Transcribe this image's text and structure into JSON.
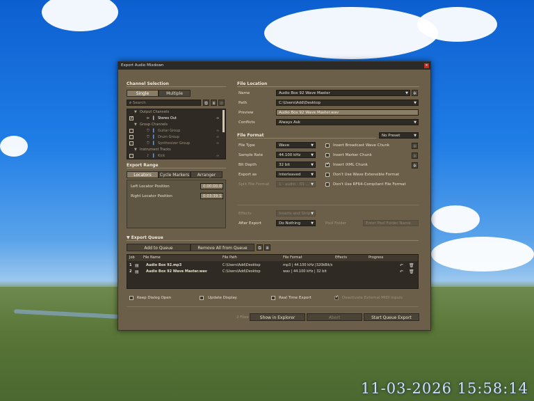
{
  "clock": "11-03-2026 15:58:14",
  "dialog": {
    "title": "Export Audio Mixdown",
    "close_glyph": "×"
  },
  "channel_selection": {
    "heading": "Channel Selection",
    "tabs": [
      "Single",
      "Multiple"
    ],
    "search_placeholder": "Search",
    "tree": [
      {
        "label": "Output Channels",
        "type": "group",
        "checked": false
      },
      {
        "label": "Stereo Out",
        "type": "item",
        "checked": true
      },
      {
        "label": "Group Channels",
        "type": "group",
        "checked": false
      },
      {
        "label": "Guitar Group",
        "type": "item",
        "checked": false
      },
      {
        "label": "Drum Group",
        "type": "item",
        "checked": false
      },
      {
        "label": "Synthesizer Group",
        "type": "item",
        "checked": false
      },
      {
        "label": "Instrument Tracks",
        "type": "group",
        "checked": false
      },
      {
        "label": "Kick",
        "type": "item",
        "checked": false
      }
    ]
  },
  "export_range": {
    "heading": "Export Range",
    "tabs": [
      "Locators",
      "Cycle Markers",
      "Arranger"
    ],
    "left_label": "Left Locator Position",
    "left_value": "0:00:00.000",
    "right_label": "Right Locator Position",
    "right_value": "0:03:39.130"
  },
  "file_location": {
    "heading": "File Location",
    "name_label": "Name",
    "name_value": "Audio Box 92 Wave Master",
    "path_label": "Path",
    "path_value": "C:\\Users\\Add\\Desktop",
    "preview_label": "Preview",
    "preview_value": "Audio Box 92 Wave Master.wav",
    "conflicts_label": "Conflicts",
    "conflicts_value": "Always Ask"
  },
  "file_format": {
    "heading": "File Format",
    "preset": "No Preset",
    "file_type_label": "File Type",
    "file_type_value": "Wave",
    "sample_rate_label": "Sample Rate",
    "sample_rate_value": "44.100 kHz",
    "bit_depth_label": "Bit Depth",
    "bit_depth_value": "32 bit",
    "export_as_label": "Export as",
    "export_as_value": "Interleaved",
    "split_label": "Split File Format",
    "split_value": "1 - audio - 01 ...",
    "options": [
      {
        "label": "Insert Broadcast Wave Chunk",
        "checked": false
      },
      {
        "label": "Insert Marker Chunk",
        "checked": false
      },
      {
        "label": "Insert iXML Chunk",
        "checked": true
      },
      {
        "label": "Don't Use Wave Extensible Format",
        "checked": false
      },
      {
        "label": "Don't Use RF64-Compliant File Format",
        "checked": false
      }
    ]
  },
  "post": {
    "effects_label": "Effects",
    "effects_value": "Inserts and Strip",
    "after_label": "After Export",
    "after_value": "Do Nothing",
    "pool_label": "Pool Folder",
    "pool_placeholder": "Enter Pool Folder Name"
  },
  "queue": {
    "heading": "Export Queue",
    "add_label": "Add to Queue",
    "remove_label": "Remove All from Queue",
    "columns": [
      "Job",
      "File Name",
      "File Path",
      "File Format",
      "Effects",
      "Progress"
    ],
    "rows": [
      {
        "job": "1",
        "name": "Audio Box 92.mp3",
        "path": "C:\\Users\\Add\\Desktop",
        "format": "mp3 | 44.100 kHz |320kBit/s"
      },
      {
        "job": "2",
        "name": "Audio Box 92 Wave Master.wav",
        "path": "C:\\Users\\Add\\Desktop",
        "format": "wav | 44.100 kHz | 32 bit"
      }
    ]
  },
  "bottom_options": [
    {
      "label": "Keep Dialog Open",
      "checked": false,
      "disabled": false
    },
    {
      "label": "Update Display",
      "checked": false,
      "disabled": false
    },
    {
      "label": "Real Time Export",
      "checked": false,
      "disabled": false
    },
    {
      "label": "Deactivate External MIDI Inputs",
      "checked": true,
      "disabled": true
    }
  ],
  "footer": {
    "count": "2 Files",
    "show_label": "Show in Explorer",
    "abort_label": "Abort",
    "start_label": "Start Queue Export"
  }
}
